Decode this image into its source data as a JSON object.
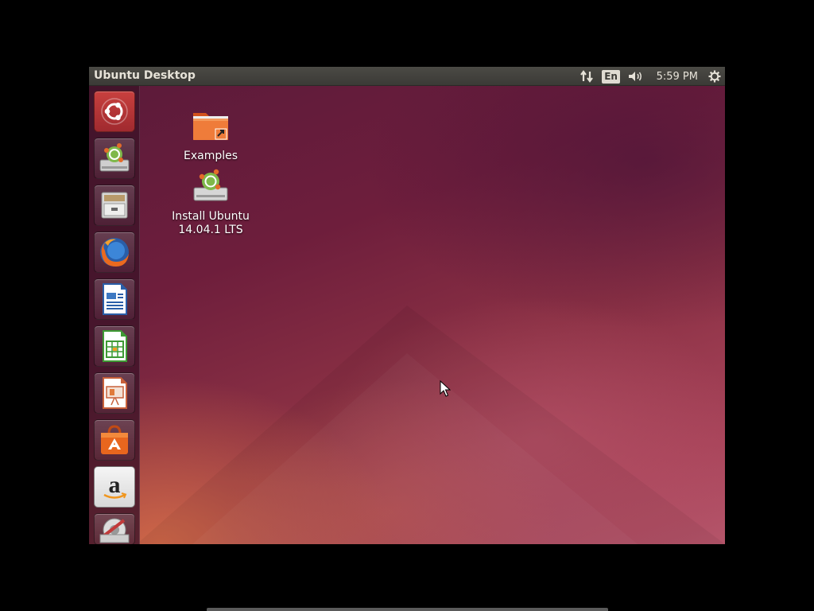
{
  "top_panel": {
    "title": "Ubuntu Desktop",
    "keyboard_layout": "En",
    "clock": "5:59 PM",
    "icons": [
      "network-icon",
      "keyboard-indicator",
      "volume-icon",
      "system-gear-icon"
    ]
  },
  "launcher": {
    "items": [
      {
        "name": "dash-home",
        "icon": "ubuntu-logo-icon"
      },
      {
        "name": "install-ubuntu",
        "icon": "installer-icon"
      },
      {
        "name": "files",
        "icon": "file-cabinet-icon"
      },
      {
        "name": "firefox",
        "icon": "firefox-icon"
      },
      {
        "name": "libreoffice-writer",
        "icon": "writer-icon"
      },
      {
        "name": "libreoffice-calc",
        "icon": "calc-icon"
      },
      {
        "name": "libreoffice-impress",
        "icon": "impress-icon"
      },
      {
        "name": "ubuntu-software-center",
        "icon": "software-center-icon"
      },
      {
        "name": "amazon",
        "icon": "amazon-icon"
      },
      {
        "name": "system-settings",
        "icon": "settings-icon"
      }
    ]
  },
  "desktop": {
    "icons": [
      {
        "label": "Examples",
        "icon": "folder-link-icon"
      },
      {
        "label": "Install Ubuntu\n14.04.1 LTS",
        "label_line1": "Install Ubuntu",
        "label_line2": "14.04.1 LTS",
        "icon": "installer-icon"
      }
    ]
  },
  "colors": {
    "panel": "#3b3a36",
    "wallpaper_dark": "#5a1a3a",
    "wallpaper_light": "#b5556a",
    "accent_orange": "#dd4814"
  }
}
